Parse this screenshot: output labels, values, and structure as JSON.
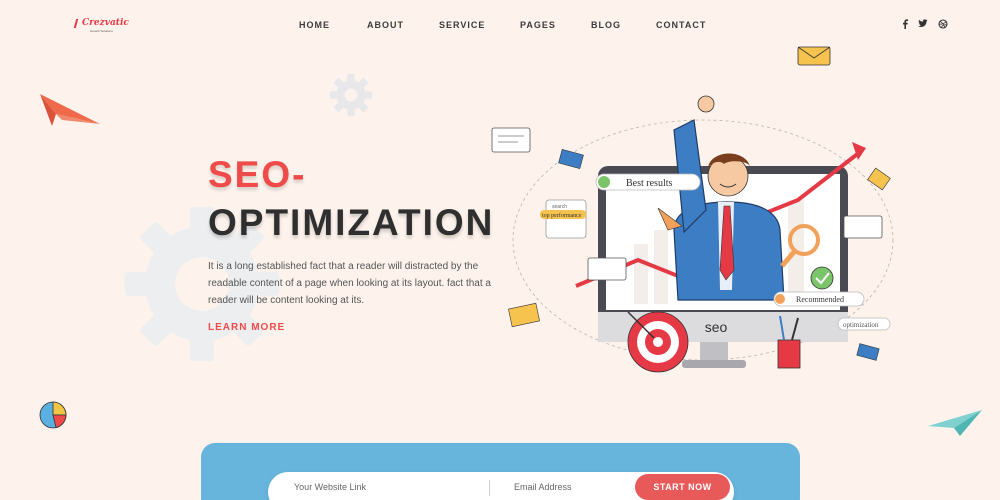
{
  "brand": {
    "name": "Crezvatic",
    "tagline": "Growth Solutions"
  },
  "nav": {
    "items": [
      "HOME",
      "ABOUT",
      "SERVICE",
      "PAGES",
      "BLOG",
      "CONTACT"
    ]
  },
  "socials": [
    {
      "icon": "facebook-icon",
      "glyph": "f"
    },
    {
      "icon": "twitter-icon",
      "glyph": "🐦"
    },
    {
      "icon": "dribbble-icon",
      "glyph": "◎"
    }
  ],
  "hero": {
    "title_line1": "SEO-",
    "title_line2": "OPTIMIZATION",
    "body": "It is a long established fact that a reader will distracted by the readable content of a page when looking at its layout. fact that a reader will be content looking at its.",
    "cta": "LEARN MORE"
  },
  "illustration": {
    "best_results": "Best results",
    "recommended": "Recommended",
    "seo": "seo",
    "search": "search",
    "top_performance": "top performance",
    "optimization": "optimization"
  },
  "form": {
    "website_placeholder": "Your Website Link",
    "email_placeholder": "Email Address",
    "submit_label": "START NOW"
  },
  "colors": {
    "background": "#fdf3ec",
    "accent_red": "#ef4b4b",
    "band_blue": "#67b4dc",
    "button_red": "#e85a5a"
  }
}
